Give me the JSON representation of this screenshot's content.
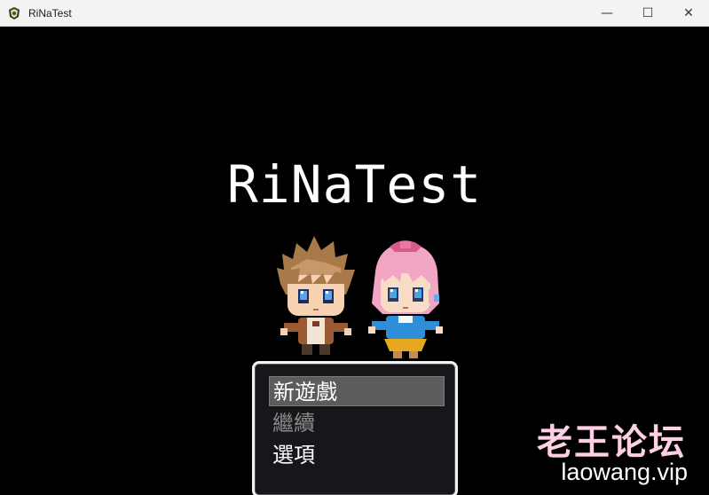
{
  "window": {
    "title": "RiNaTest",
    "icon": "app-icon",
    "controls": {
      "minimize": "—",
      "maximize": "☐",
      "close": "✕"
    }
  },
  "game": {
    "title": "RiNaTest",
    "menu": [
      {
        "label": "新遊戲",
        "state": "selected"
      },
      {
        "label": "繼續",
        "state": "disabled"
      },
      {
        "label": "選項",
        "state": "normal"
      }
    ]
  },
  "watermark": {
    "cn": "老王论坛",
    "url": "laowang.vip"
  }
}
